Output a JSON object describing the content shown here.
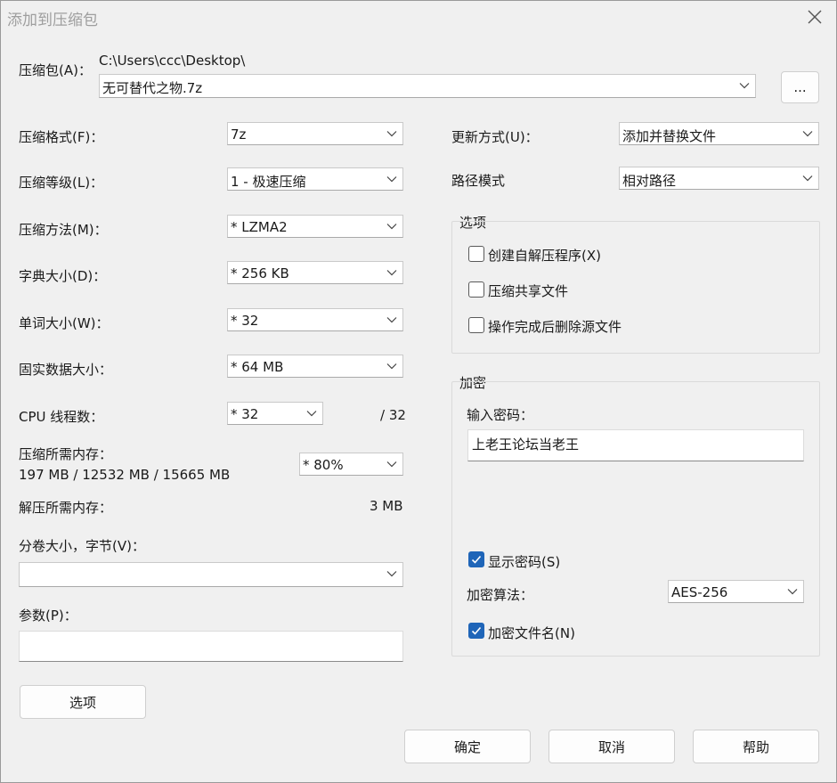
{
  "window": {
    "title": "添加到压缩包"
  },
  "archive": {
    "label": "压缩包(A)：",
    "path": "C:\\Users\\ccc\\Desktop\\",
    "filename": "无可替代之物.7z",
    "browse_label": "..."
  },
  "format": {
    "label": "压缩格式(F)：",
    "value": "7z"
  },
  "level": {
    "label": "压缩等级(L)：",
    "value": "1 - 极速压缩"
  },
  "method": {
    "label": "压缩方法(M)：",
    "value": "*  LZMA2"
  },
  "dict": {
    "label": "字典大小(D)：",
    "value": "*  256 KB"
  },
  "word": {
    "label": "单词大小(W)：",
    "value": "*  32"
  },
  "solid": {
    "label": "固实数据大小：",
    "value": "*  64 MB"
  },
  "cpu": {
    "label": "CPU 线程数：",
    "value": "*  32",
    "max": "/ 32"
  },
  "mem_compress": {
    "label": "压缩所需内存：",
    "value": "197 MB / 12532 MB / 15665 MB",
    "percent": "*  80%"
  },
  "mem_decompress": {
    "label": "解压所需内存：",
    "value": "3 MB"
  },
  "volume": {
    "label": "分卷大小，字节(V)：",
    "value": ""
  },
  "params": {
    "label": "参数(P)：",
    "value": ""
  },
  "options_button": "选项",
  "update": {
    "label": "更新方式(U)：",
    "value": "添加并替换文件"
  },
  "pathmode": {
    "label": "路径模式",
    "value": "相对路径"
  },
  "options_group": {
    "title": "选项",
    "items": [
      {
        "label": "创建自解压程序(X)",
        "checked": false
      },
      {
        "label": "压缩共享文件",
        "checked": false
      },
      {
        "label": "操作完成后删除源文件",
        "checked": false
      }
    ]
  },
  "encryption": {
    "title": "加密",
    "password_label": "输入密码：",
    "password": "上老王论坛当老王",
    "show_password_label": "显示密码(S)",
    "show_password_checked": true,
    "algo_label": "加密算法：",
    "algo_value": "AES-256",
    "encrypt_names_label": "加密文件名(N)",
    "encrypt_names_checked": true
  },
  "buttons": {
    "ok": "确定",
    "cancel": "取消",
    "help": "帮助"
  },
  "colors": {
    "accent": "#1f65b8",
    "background": "#f0f0f0"
  },
  "icons": {
    "close": "close-icon",
    "dropdown": "chevron-down-icon",
    "check": "check-icon"
  }
}
